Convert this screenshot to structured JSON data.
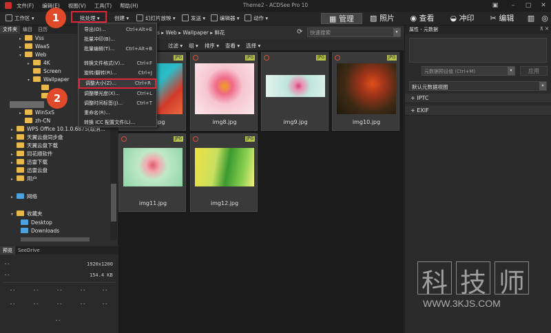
{
  "app_title": "Theme2 - ACDSee Pro 10",
  "menu": [
    "文件(F)",
    "编辑(E)",
    "视图(V)",
    "工具(T)",
    "帮助(H)"
  ],
  "toolbar": {
    "workspace": "工作区",
    "batch": "批处理",
    "create": "创建",
    "slideshow": "幻灯片放映",
    "send": "发送",
    "editor": "编辑器",
    "action": "动作"
  },
  "modes": [
    "管理",
    "照片",
    "查看",
    "冲印",
    "编辑"
  ],
  "left_tabs": [
    "文件夹",
    "编目",
    "日历"
  ],
  "tree": [
    {
      "label": "Vss",
      "level": 2,
      "arrow": "▸"
    },
    {
      "label": "WaaS",
      "level": 2,
      "arrow": "▸"
    },
    {
      "label": "Web",
      "level": 2,
      "arrow": "▾"
    },
    {
      "label": "4K",
      "level": 3,
      "arrow": "▸"
    },
    {
      "label": "Screen",
      "level": 3,
      "arrow": ""
    },
    {
      "label": "Wallpaper",
      "level": 3,
      "arrow": "▾"
    },
    {
      "label": "WinSxS",
      "level": 2,
      "arrow": "▸"
    },
    {
      "label": "zh-CN",
      "level": 2,
      "arrow": ""
    },
    {
      "label": "WPS Office 10.1.0.6875(取消...",
      "level": 1,
      "arrow": "▸"
    },
    {
      "label": "天翼云盘同步盘",
      "level": 1,
      "arrow": "▸"
    },
    {
      "label": "天翼云盘下载",
      "level": 1,
      "arrow": ""
    },
    {
      "label": "同花顺软件",
      "level": 1,
      "arrow": "▸"
    },
    {
      "label": "迅雷下载",
      "level": 1,
      "arrow": "▸"
    },
    {
      "label": "迅雷云盘",
      "level": 1,
      "arrow": ""
    },
    {
      "label": "用户",
      "level": 1,
      "arrow": "▸"
    }
  ],
  "network": "网络",
  "favorites": "收藏夹",
  "fav_items": [
    "Desktop",
    "Downloads"
  ],
  "preview_tabs": [
    "预览",
    "SeeDrive"
  ],
  "preview_info": {
    "dims": "1920x1200",
    "size": "154.4 KB",
    "dash": "--"
  },
  "path": [
    "Web",
    "Wallpaper",
    "鲜花"
  ],
  "path_prefix": "s",
  "search_placeholder": "快速搜索",
  "filter_bar": [
    "过滤",
    "组",
    "排序",
    "查看",
    "选择"
  ],
  "thumbs": [
    {
      "name": "img7.jpg",
      "badge": "JPG"
    },
    {
      "name": "img8.jpg",
      "badge": "JPG"
    },
    {
      "name": "img9.jpg",
      "badge": "JPG"
    },
    {
      "name": "img10.jpg",
      "badge": "JPG"
    },
    {
      "name": "img11.jpg",
      "badge": "JPG"
    },
    {
      "name": "img12.jpg",
      "badge": "JPG"
    }
  ],
  "dropdown": [
    {
      "label": "导出(O)...",
      "shortcut": "Ctrl+Alt+E"
    },
    {
      "label": "批量冲印(B)...",
      "shortcut": ""
    },
    {
      "label": "批量编辑(T)...",
      "shortcut": "Ctrl+Alt+B"
    },
    {
      "label": "转换文件格式(V)...",
      "shortcut": "Ctrl+F"
    },
    {
      "label": "旋转/翻转(R)...",
      "shortcut": "Ctrl+J"
    },
    {
      "label": "调整大小(Z)...",
      "shortcut": "Ctrl+R"
    },
    {
      "label": "调整曝光度(X)...",
      "shortcut": "Ctrl+L"
    },
    {
      "label": "调整时间标签(J)...",
      "shortcut": "Ctrl+T"
    },
    {
      "label": "重命名(R)...",
      "shortcut": ""
    },
    {
      "label": "转换 ICC 配置文件(L)...",
      "shortcut": ""
    }
  ],
  "badges": [
    "1",
    "2"
  ],
  "right_panel": {
    "title": "属性 - 元数据",
    "preset_placeholder": "元数据预设值 (Ctrl+M)",
    "apply": "应用",
    "view": "默认元数据视图",
    "sections": [
      "IPTC",
      "EXIF"
    ]
  },
  "watermark": {
    "chars": [
      "科",
      "技",
      "师"
    ],
    "url": "WWW.3KJS.COM"
  },
  "colors": {
    "highlight": "#e0243a",
    "badge": "#e04a2a",
    "jpg_badge": "#b6c24a",
    "folder": "#e8b84a"
  }
}
